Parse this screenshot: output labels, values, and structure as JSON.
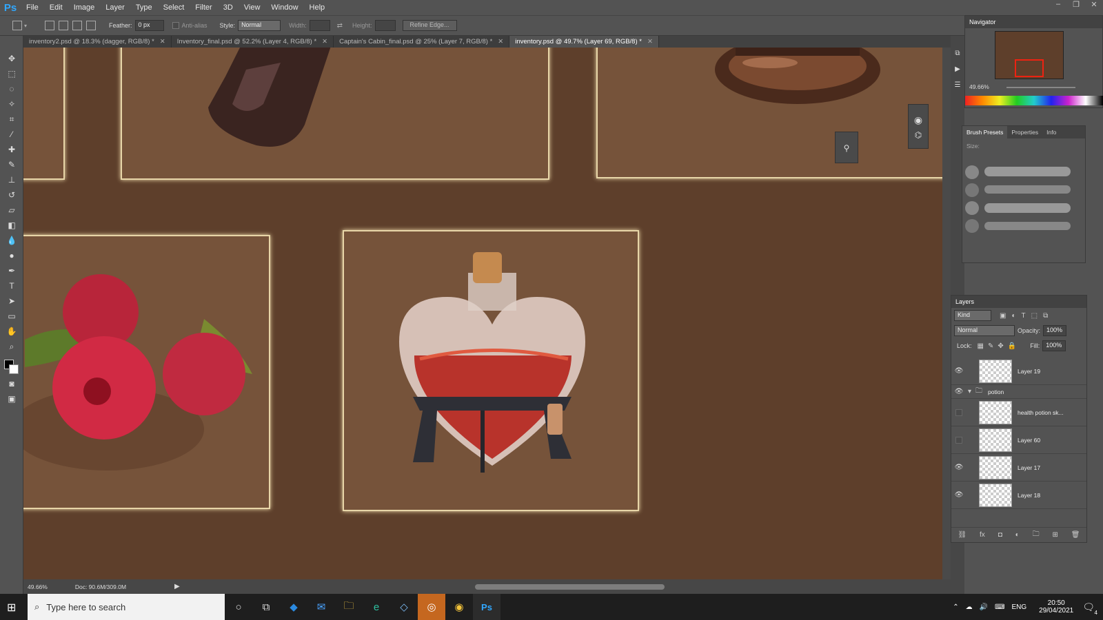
{
  "menu": {
    "logo": "Ps",
    "items": [
      "File",
      "Edit",
      "Image",
      "Layer",
      "Type",
      "Select",
      "Filter",
      "3D",
      "View",
      "Window",
      "Help"
    ]
  },
  "options": {
    "feather_label": "Feather:",
    "feather_value": "0 px",
    "antialias_label": "Anti-alias",
    "style_label": "Style:",
    "style_value": "Normal",
    "width_label": "Width:",
    "height_label": "Height:",
    "refine_edge": "Refine Edge..."
  },
  "tabs": [
    {
      "label": "inventory2.psd @ 18.3% (dagger, RGB/8) *"
    },
    {
      "label": "Inventory_final.psd @ 52.2% (Layer 4, RGB/8) *"
    },
    {
      "label": "Captain's Cabin_final.psd @ 25% (Layer 7, RGB/8) *"
    },
    {
      "label": "inventory.psd @ 49.7% (Layer 69, RGB/8) *"
    }
  ],
  "status": {
    "zoom": "49.66%",
    "doc": "Doc: 90.6M/309.0M"
  },
  "navigator": {
    "title": "Navigator",
    "zoom": "49.66%"
  },
  "brush_panel": {
    "tabs": [
      "Brush Presets",
      "Properties",
      "Info"
    ],
    "size_label": "Size:"
  },
  "layers_panel": {
    "title": "Layers",
    "kind": "Kind",
    "blend_mode": "Normal",
    "opacity_label": "Opacity:",
    "opacity_value": "100%",
    "lock_label": "Lock:",
    "fill_label": "Fill:",
    "fill_value": "100%",
    "layers": [
      {
        "name": "Layer 19",
        "visible": true
      },
      {
        "name": "potion",
        "visible": true
      },
      {
        "name": "health potion sk...",
        "visible": false
      },
      {
        "name": "Layer 60",
        "visible": false
      },
      {
        "name": "Layer 17",
        "visible": true
      },
      {
        "name": "Layer 18",
        "visible": true
      }
    ]
  },
  "taskbar": {
    "search_placeholder": "Type here to search",
    "lang": "ENG",
    "time": "20:50",
    "date": "29/04/2021",
    "notifications": "4"
  },
  "colors": {
    "canvas_bg": "#5e3f2b",
    "slot_fill": "#76533a",
    "slot_glow": "#e8d6a8",
    "ps_blue": "#31a8ff"
  }
}
